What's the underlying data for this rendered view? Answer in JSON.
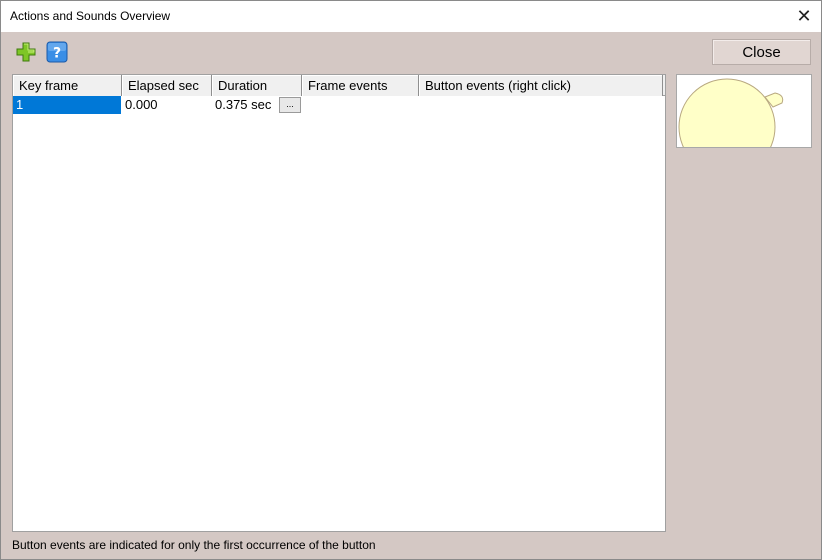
{
  "window": {
    "title": "Actions and Sounds Overview"
  },
  "toolbar": {
    "add_icon": "add-icon",
    "help_icon": "help-icon",
    "help_glyph": "?",
    "close_label": "Close"
  },
  "grid": {
    "columns": [
      "Key frame",
      "Elapsed sec",
      "Duration",
      "Frame events",
      "Button events (right click)"
    ],
    "rows": [
      {
        "key_frame": "1",
        "elapsed": "0.000",
        "duration": "0.375 sec",
        "duration_button": "...",
        "frame_events": "",
        "button_events": ""
      }
    ]
  },
  "colors": {
    "window_bg": "#d4c8c4",
    "selection": "#0078d7",
    "preview_shape_fill": "#ffffc8",
    "add_green": "#7ec626",
    "help_blue": "#3a8ee6"
  },
  "status_text": "Button events are indicated for only the first occurrence of the button"
}
